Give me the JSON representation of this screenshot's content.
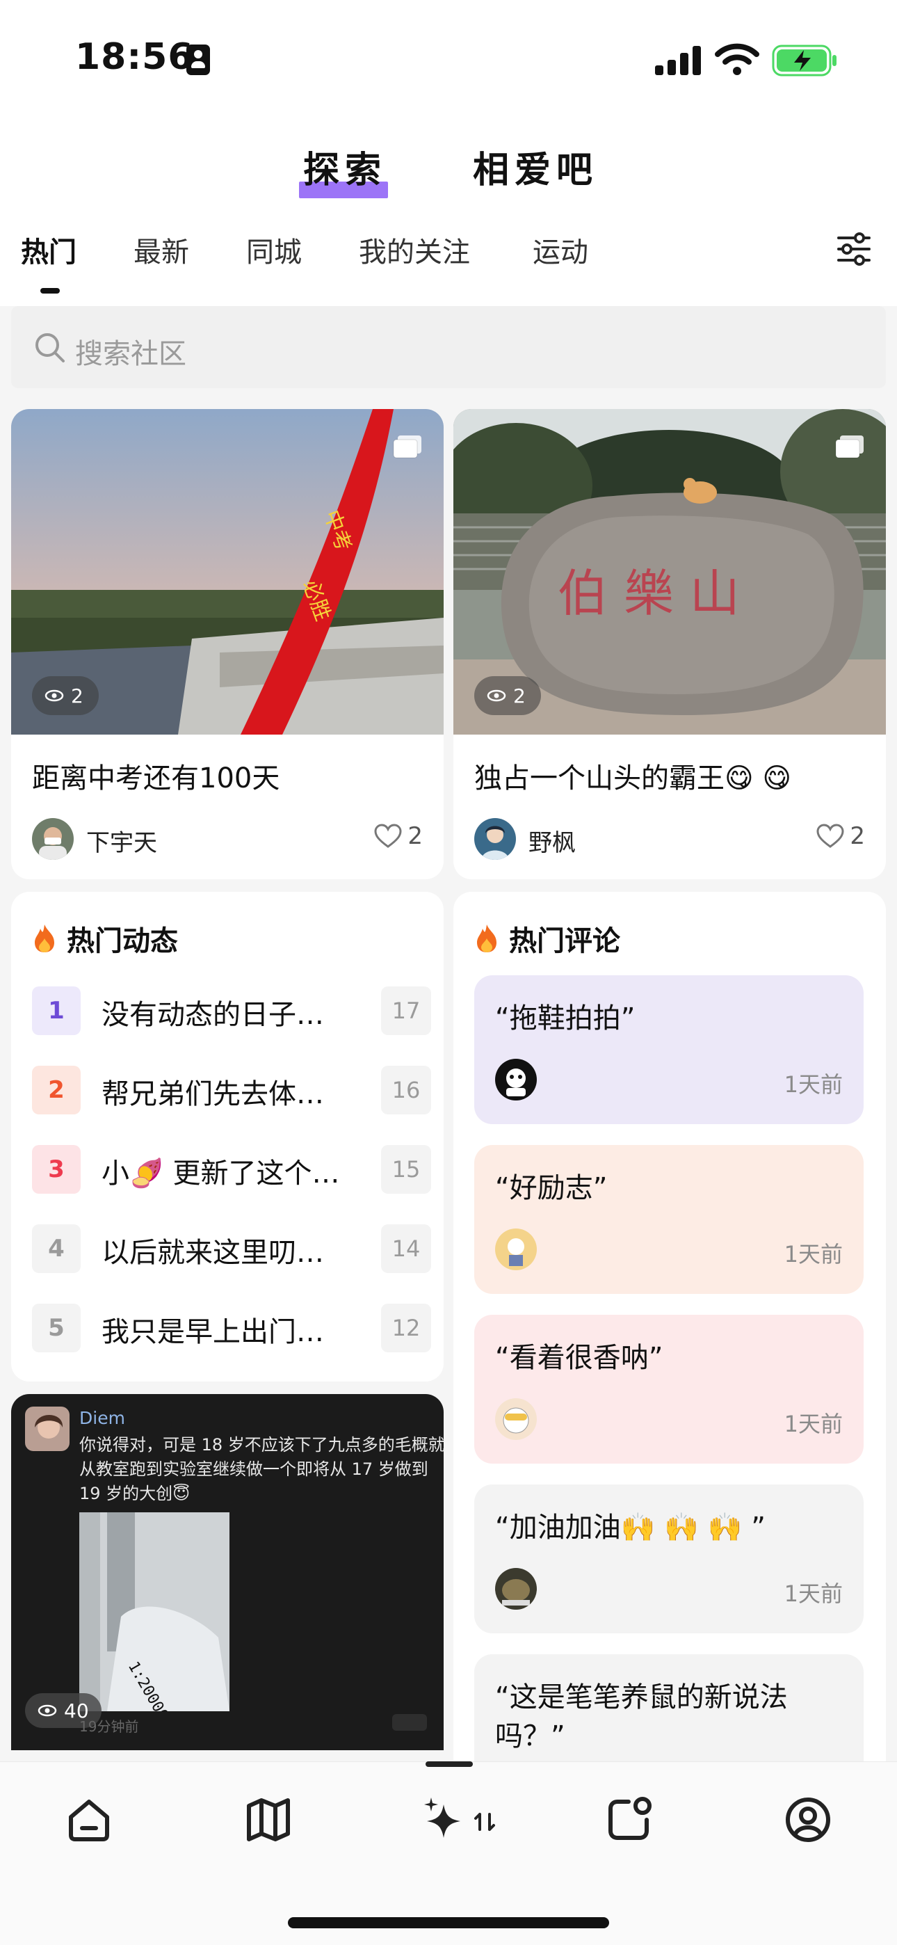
{
  "status_bar": {
    "time": "18:56"
  },
  "header": {
    "top_tabs": [
      {
        "label": "探索",
        "active": true
      },
      {
        "label": "相爱吧",
        "active": false
      }
    ],
    "category_tabs": [
      "热门",
      "最新",
      "同城",
      "我的关注",
      "运动"
    ],
    "active_category": "热门"
  },
  "search": {
    "placeholder": "搜索社区"
  },
  "posts": [
    {
      "title": "距离中考还有100天",
      "author": "下宇天",
      "likes": "2",
      "views": "2"
    },
    {
      "title": "独占一个山头的霸王😋 😋",
      "author": "野枫",
      "likes": "2",
      "views": "2"
    }
  ],
  "hot_posts": {
    "title": "热门动态",
    "items": [
      {
        "rank": "1",
        "text": "没有动态的日子…",
        "count": "17"
      },
      {
        "rank": "2",
        "text": "帮兄弟们先去体…",
        "count": "16"
      },
      {
        "rank": "3",
        "text": "小🍠 更新了这个…",
        "count": "15"
      },
      {
        "rank": "4",
        "text": "以后就来这里叨…",
        "count": "14"
      },
      {
        "rank": "5",
        "text": "我只是早上出门…",
        "count": "12"
      }
    ]
  },
  "hot_comments": {
    "title": "热门评论",
    "items": [
      {
        "text": "“拖鞋拍拍”",
        "time": "1天前",
        "bg": "#ece8f8"
      },
      {
        "text": "“好励志”",
        "time": "1天前",
        "bg": "#fdece4"
      },
      {
        "text": "“看着很香呐”",
        "time": "1天前",
        "bg": "#fde9ea"
      },
      {
        "text": "“加油加油🙌 🙌 🙌 ”",
        "time": "1天前",
        "bg": "#f3f3f3"
      },
      {
        "text": "“这是笔笔养鼠的新说法吗？”",
        "time": "",
        "bg": "#f3f3f3"
      }
    ]
  },
  "screenshot_post": {
    "name": "Diem",
    "body": "你说得对，可是 18 岁不应该下了九点多的毛概就从教室跑到实验室继续做一个即将从 17 岁做到 19 岁的大创😇",
    "meta": "19分钟前",
    "views": "40"
  },
  "colors": {
    "accent": "#8b5cf6",
    "rank1_bg": "#ede9fb",
    "rank1_fg": "#6d4bd6",
    "rank2_bg": "#fde6df",
    "rank2_fg": "#f0552e",
    "rank3_bg": "#fde3e6",
    "rank3_fg": "#ee3b4f",
    "rank_other_bg": "#f3f3f3",
    "rank_other_fg": "#9a9a9a"
  },
  "bottom_nav": [
    "home-icon",
    "map-icon",
    "sparkles-icon",
    "note-icon",
    "profile-icon"
  ]
}
